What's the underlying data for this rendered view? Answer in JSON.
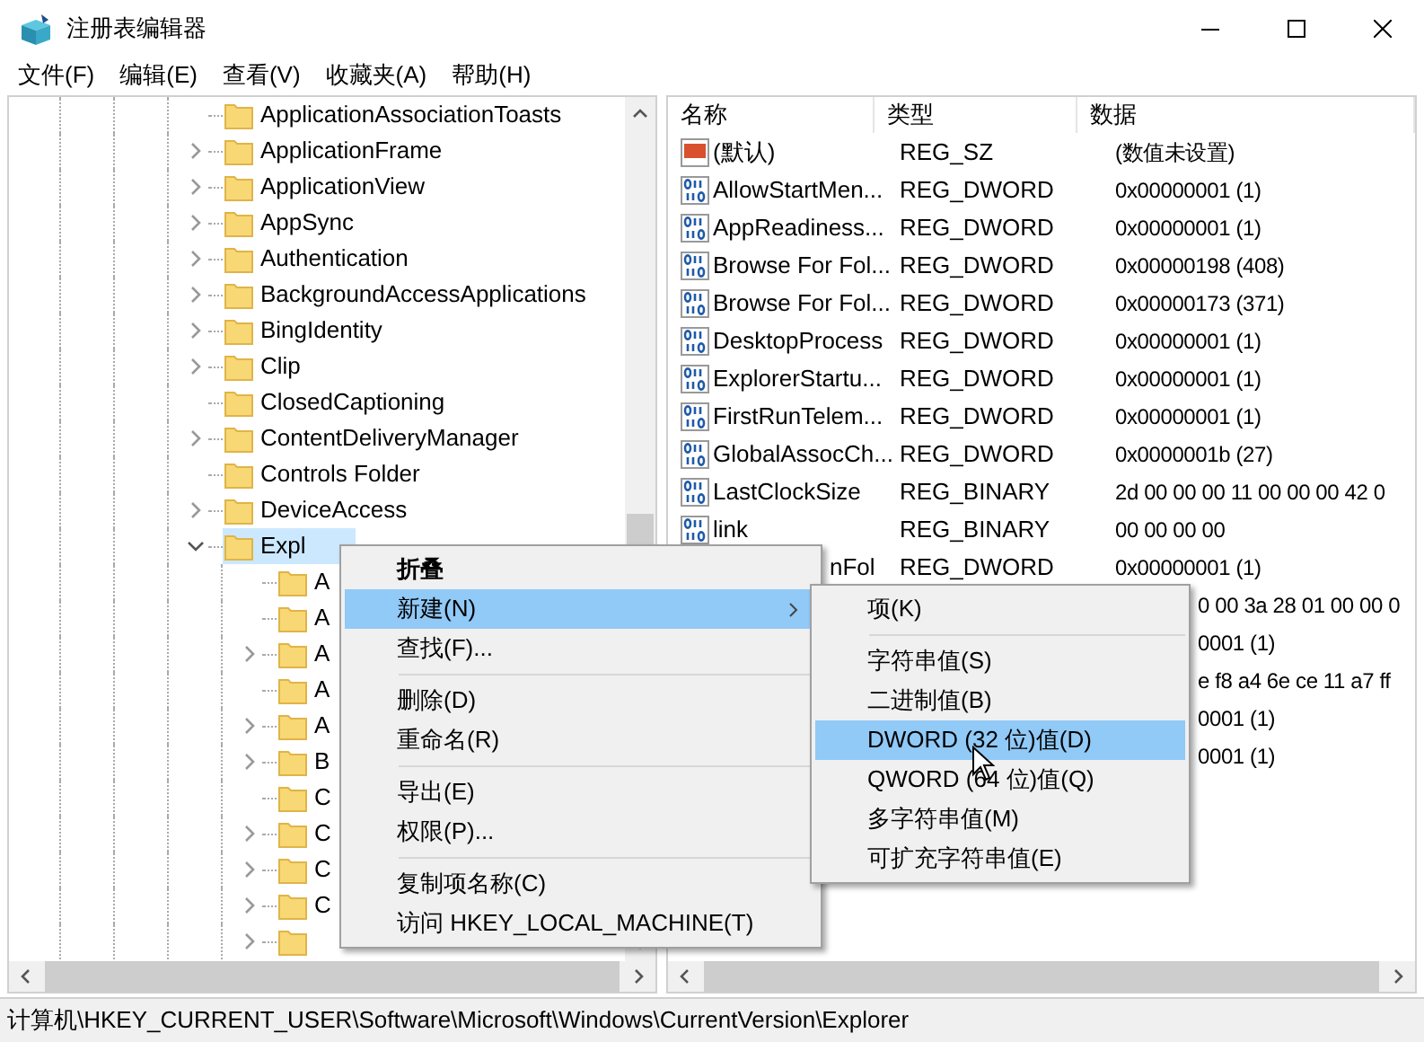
{
  "window": {
    "title": "注册表编辑器"
  },
  "menu_bar": [
    "文件(F)",
    "编辑(E)",
    "查看(V)",
    "收藏夹(A)",
    "帮助(H)"
  ],
  "tree": {
    "items": [
      {
        "label": "ApplicationAssociationToasts",
        "has_children": false,
        "selected": false
      },
      {
        "label": "ApplicationFrame",
        "has_children": true,
        "selected": false
      },
      {
        "label": "ApplicationView",
        "has_children": true,
        "selected": false
      },
      {
        "label": "AppSync",
        "has_children": true,
        "selected": false
      },
      {
        "label": "Authentication",
        "has_children": true,
        "selected": false
      },
      {
        "label": "BackgroundAccessApplications",
        "has_children": true,
        "selected": false
      },
      {
        "label": "BingIdentity",
        "has_children": true,
        "selected": false
      },
      {
        "label": "Clip",
        "has_children": true,
        "selected": false
      },
      {
        "label": "ClosedCaptioning",
        "has_children": false,
        "selected": false
      },
      {
        "label": "ContentDeliveryManager",
        "has_children": true,
        "selected": false
      },
      {
        "label": "Controls Folder",
        "has_children": false,
        "selected": false
      },
      {
        "label": "DeviceAccess",
        "has_children": true,
        "selected": false
      },
      {
        "label": "Expl",
        "has_children": true,
        "selected": true,
        "expanded": true,
        "children": [
          {
            "label": "A",
            "has_children": false,
            "selected": false
          },
          {
            "label": "A",
            "has_children": false,
            "selected": false
          },
          {
            "label": "A",
            "has_children": true,
            "selected": false
          },
          {
            "label": "A",
            "has_children": false,
            "selected": false
          },
          {
            "label": "A",
            "has_children": true,
            "selected": false
          },
          {
            "label": "B",
            "has_children": true,
            "selected": false
          },
          {
            "label": "C",
            "has_children": false,
            "selected": false
          },
          {
            "label": "C",
            "has_children": true,
            "selected": false
          },
          {
            "label": "C",
            "has_children": true,
            "selected": false
          },
          {
            "label": "C",
            "has_children": true,
            "selected": false
          },
          {
            "has_children": true,
            "selected": false
          }
        ]
      }
    ]
  },
  "values": {
    "columns": [
      "名称",
      "类型",
      "数据"
    ],
    "rows": [
      {
        "kind": "string",
        "name": "(默认)",
        "type": "REG_SZ",
        "data": "(数值未设置)"
      },
      {
        "kind": "binary",
        "name": "AllowStartMen...",
        "type": "REG_DWORD",
        "data": "0x00000001 (1)"
      },
      {
        "kind": "binary",
        "name": "AppReadiness...",
        "type": "REG_DWORD",
        "data": "0x00000001 (1)"
      },
      {
        "kind": "binary",
        "name": "Browse For Fol...",
        "type": "REG_DWORD",
        "data": "0x00000198 (408)"
      },
      {
        "kind": "binary",
        "name": "Browse For Fol...",
        "type": "REG_DWORD",
        "data": "0x00000173 (371)"
      },
      {
        "kind": "binary",
        "name": "DesktopProcess",
        "type": "REG_DWORD",
        "data": "0x00000001 (1)"
      },
      {
        "kind": "binary",
        "name": "ExplorerStartu...",
        "type": "REG_DWORD",
        "data": "0x00000001 (1)"
      },
      {
        "kind": "binary",
        "name": "FirstRunTelem...",
        "type": "REG_DWORD",
        "data": "0x00000001 (1)"
      },
      {
        "kind": "binary",
        "name": "GlobalAssocCh...",
        "type": "REG_DWORD",
        "data": "0x0000001b (27)"
      },
      {
        "kind": "binary",
        "name": "LastClockSize",
        "type": "REG_BINARY",
        "data": "2d 00 00 00 11 00 00 00 42 0"
      },
      {
        "kind": "binary",
        "name": "link",
        "type": "REG_BINARY",
        "data": "00 00 00 00"
      },
      {
        "kind": "name_cut",
        "name": "nFol",
        "type": "REG_DWORD",
        "data": "0x00000001 (1)"
      },
      {
        "kind": "data_cut",
        "data": "0 00 3a 28 01 00 00 0"
      },
      {
        "kind": "data_cut",
        "data": "0001 (1)"
      },
      {
        "kind": "data_cut",
        "data": "e f8 a4 6e ce 11 a7 ff"
      },
      {
        "kind": "data_cut",
        "data": "0001 (1)"
      },
      {
        "kind": "data_cut",
        "data": "0001 (1)"
      }
    ]
  },
  "context_menu": {
    "items": [
      {
        "kind": "item",
        "label": "折叠",
        "bold": true,
        "selected": false
      },
      {
        "kind": "submenu",
        "label": "新建(N)",
        "selected": true
      },
      {
        "kind": "item",
        "label": "查找(F)...",
        "selected": false
      },
      {
        "kind": "separator"
      },
      {
        "kind": "item",
        "label": "删除(D)",
        "selected": false
      },
      {
        "kind": "item",
        "label": "重命名(R)",
        "selected": false
      },
      {
        "kind": "separator"
      },
      {
        "kind": "item",
        "label": "导出(E)",
        "selected": false
      },
      {
        "kind": "item",
        "label": "权限(P)...",
        "selected": false
      },
      {
        "kind": "separator"
      },
      {
        "kind": "item",
        "label": "复制项名称(C)",
        "selected": false
      },
      {
        "kind": "item",
        "label": "访问 HKEY_LOCAL_MACHINE(T)",
        "selected": false
      }
    ]
  },
  "submenu": {
    "items": [
      {
        "kind": "item",
        "label": "项(K)",
        "selected": false
      },
      {
        "kind": "separator"
      },
      {
        "kind": "item",
        "label": "字符串值(S)",
        "selected": false
      },
      {
        "kind": "item",
        "label": "二进制值(B)",
        "selected": false
      },
      {
        "kind": "item",
        "label": "DWORD (32 位)值(D)",
        "selected": true
      },
      {
        "kind": "item",
        "label": "QWORD (64 位)值(Q)",
        "selected": false
      },
      {
        "kind": "item",
        "label": "多字符串值(M)",
        "selected": false
      },
      {
        "kind": "item",
        "label": "可扩充字符串值(E)",
        "selected": false
      }
    ]
  },
  "status_bar": "计算机\\HKEY_CURRENT_USER\\Software\\Microsoft\\Windows\\CurrentVersion\\Explorer"
}
